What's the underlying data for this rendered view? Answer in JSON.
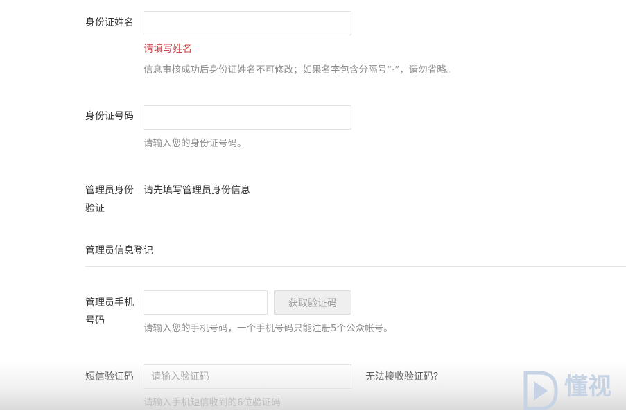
{
  "fields": {
    "name": {
      "label": "身份证姓名",
      "value": "",
      "error": "请填写姓名",
      "hint": "信息审核成功后身份证姓名不可修改；如果名字包含分隔号“·”，请勿省略。"
    },
    "id_number": {
      "label": "身份证号码",
      "value": "",
      "hint": "请输入您的身份证号码。"
    },
    "admin_verify": {
      "label_line1": "管理员身份",
      "label_line2": "验证",
      "text": "请先填写管理员身份信息"
    },
    "phone": {
      "label_line1": "管理员手机",
      "label_line2": "号码",
      "value": "",
      "button": "获取验证码",
      "hint": "请输入您的手机号码，一个手机号码只能注册5个公众帐号。"
    },
    "sms_code": {
      "label": "短信验证码",
      "placeholder": "请输入验证码",
      "help_link": "无法接收验证码？",
      "hint": "请输入手机短信收到的6位验证码"
    }
  },
  "section": {
    "title": "管理员信息登记"
  },
  "watermark": {
    "text": "懂视",
    "icon": "play-logo-icon"
  },
  "colors": {
    "error": "#c9474c",
    "hint": "#8d8d8d",
    "border": "#e2e2e2",
    "watermark": "#c6d3e4"
  }
}
